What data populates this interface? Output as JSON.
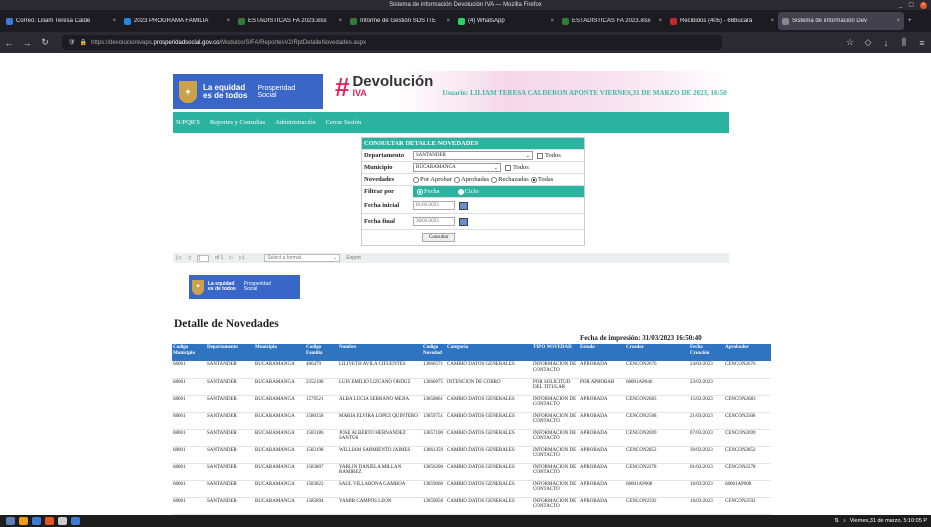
{
  "window": {
    "title": "Sistema de información Devolución IVA — Mozilla Firefox"
  },
  "tabs": [
    {
      "label": "Correo: Liliam Teresa Calde",
      "color": "#3b7bd4"
    },
    {
      "label": "2023 PROGRAMA FAMILIA",
      "color": "#1e88e5"
    },
    {
      "label": "ESTADISTICAS FA 2023.xlsx",
      "color": "#2e7d32"
    },
    {
      "label": "Informe de Gestión SDS ITE",
      "color": "#2e7d32"
    },
    {
      "label": "(4) WhatsApp",
      "color": "#25d366"
    },
    {
      "label": "ESTADISTICAS FA 2023.xlsx",
      "color": "#2e7d32"
    },
    {
      "label": "Recibidos (405) - 68bucara",
      "color": "#c62828"
    },
    {
      "label": "Sistema de información Dev",
      "color": "#888888"
    }
  ],
  "address": {
    "prefix": "https://devolucionivaps.",
    "domain": "prosperidadsocial.gov.co",
    "path": "/Modulos/SIFA/ReportesV2/RptDetalleNovedades.aspx"
  },
  "banner": {
    "logo_line1": "La equidad",
    "logo_line2": "es de todos",
    "logo_ps1": "Prosperidad",
    "logo_ps2": "Social",
    "dev_title": "Devolución",
    "dev_sub": "IVA",
    "user_text": "Usuario: LILIAM TERESA CALDERON APONTE VIERNES,31 DE MARZO DE 2023, 16:50"
  },
  "menu": [
    "N/PQR'S",
    "Reportes y Consultas",
    "Administración",
    "Cerrar Sesión"
  ],
  "form": {
    "header": "CONSULTAR DETALLE NOVEDADES",
    "departamento_label": "Departamento",
    "departamento_value": "SANTANDER",
    "todos": "Todos",
    "municipio_label": "Municipio",
    "municipio_value": "BUCARAMANGA",
    "novedades_label": "Novedades",
    "nov_options": [
      "Por Aprobar",
      "Aprobadas",
      "Rechazadas",
      "Todas"
    ],
    "filtrar_label": "Filtrar por",
    "filtrar_options": [
      "Fecha",
      "Ciclo"
    ],
    "fecha_inicial_label": "Fecha inicial",
    "fecha_inicial_value": "01/03/2023",
    "fecha_final_label": "Fecha final",
    "fecha_final_value": "30/03/2023",
    "consultar": "Consultar"
  },
  "report_toolbar": {
    "page": "1",
    "of": "of 1",
    "format_placeholder": "Select a format",
    "export": "Export"
  },
  "report": {
    "title": "Detalle de Novedades",
    "print_date": "Fecha de impresión: 31/03/2023 16:50:40",
    "columns": [
      "Codigo Municipio",
      "Departamento",
      "Municipio",
      "Codigo Familia",
      "Nombre",
      "Codigo Novedad",
      "Categoria",
      "TIPO NOVEDAD",
      "Estado",
      "Creador",
      "Fecha Creación",
      "Aprobador"
    ],
    "rows": [
      [
        "68001",
        "SANTANDER",
        "BUCARAMANGA",
        "486479",
        "LILIVETH AVILA CIFUENTES",
        "13860571",
        "CAMBIO DATOS GENERALES",
        "INFORMACION DE CONTACTO",
        "APROBADA",
        "CENCON2676",
        "24/03/2023",
        "CENCON2676"
      ],
      [
        "68001",
        "SANTANDER",
        "BUCARAMANGA",
        "2352108",
        "LUIS EMILIO LIZCANO ORDUZ",
        "13860075",
        "INTENCION DE COBRO",
        "POR SOLICITUD DEL TITULAR",
        "POR APROBAR",
        "68001AP046",
        "23/03/2023",
        ""
      ],
      [
        "68001",
        "SANTANDER",
        "BUCARAMANGA",
        "1579521",
        "ALBA LUCIA SERRANO MEJIA",
        "13858861",
        "CAMBIO DATOS GENERALES",
        "INFORMACION DE CONTACTO",
        "APROBADA",
        "CENCON2683",
        "15/03/2023",
        "CENCON2683"
      ],
      [
        "68001",
        "SANTANDER",
        "BUCARAMANGA",
        "1580158",
        "MARIA ELVIRA LOPEZ QUINTERO",
        "13859751",
        "CAMBIO DATOS GENERALES",
        "INFORMACION DE CONTACTO",
        "APROBADA",
        "CENCON2508",
        "21/03/2023",
        "CENCON2508"
      ],
      [
        "68001",
        "SANTANDER",
        "BUCARAMANGA",
        "1583186",
        "JOSE ALBERTO HERNANDEZ SANTOS",
        "13857100",
        "CAMBIO DATOS GENERALES",
        "INFORMACION DE CONTACTO",
        "APROBADA",
        "CENCON2699",
        "07/03/2023",
        "CENCON2699"
      ],
      [
        "68001",
        "SANTANDER",
        "BUCARAMANGA",
        "1583198",
        "WILLIAM SARMIENTO JAIMES",
        "13861359",
        "CAMBIO DATOS GENERALES",
        "INFORMACION DE CONTACTO",
        "APROBADA",
        "CENCON2852",
        "30/03/2023",
        "CENCON2852"
      ],
      [
        "68001",
        "SANTANDER",
        "BUCARAMANGA",
        "1583807",
        "YARLIN DANIELA MILLAN RAMIREZ",
        "13856200",
        "CAMBIO DATOS GENERALES",
        "INFORMACION DE CONTACTO",
        "APROBADA",
        "CENCON2278",
        "01/03/2023",
        "CENCON2278"
      ],
      [
        "68001",
        "SANTANDER",
        "BUCARAMANGA",
        "1583822",
        "SAUL VILLABONA GAMBOA",
        "13859060",
        "CAMBIO DATOS GENERALES",
        "INFORMACION DE CONTACTO",
        "APROBADA",
        "68001AP008",
        "16/03/2023",
        "68001AP008"
      ],
      [
        "68001",
        "SANTANDER",
        "BUCARAMANGA",
        "1585894",
        "YAMIR CAMPOS LEON",
        "13859058",
        "CAMBIO DATOS GENERALES",
        "INFORMACION DE CONTACTO",
        "APROBADA",
        "CENCON2592",
        "16/03/2023",
        "CENCON2592"
      ]
    ]
  },
  "taskbar": {
    "clock": "Viernes,31 de marzo, 5:10:05 P"
  }
}
